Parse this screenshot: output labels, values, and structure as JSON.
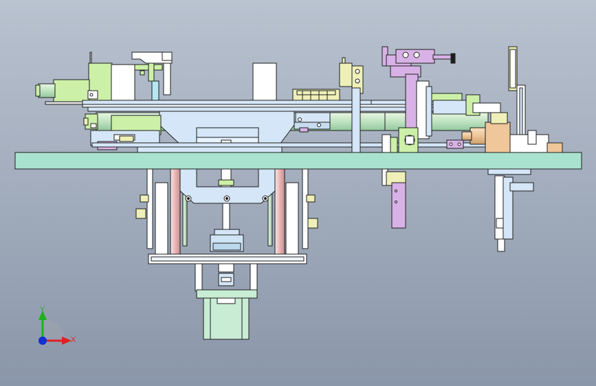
{
  "colors": {
    "background_top": "#b9c2cf",
    "background_bottom": "#8a96a9",
    "base_plate": "#a9e3cf",
    "frame_blue": "#d4e6f7",
    "motor": "#c8ecd4",
    "gripper_purple": "#d8b2e6",
    "block_yellow": "#eef0b8",
    "light_green": "#ccf0a8",
    "tan": "#efc79a",
    "rod_pink": "#f0c8c8",
    "outline": "#1e1e1e"
  },
  "triad": {
    "x_label": "X",
    "y_label": "Y",
    "x_color": "#e02020",
    "y_color": "#20b020",
    "z_color": "#1030d0"
  }
}
